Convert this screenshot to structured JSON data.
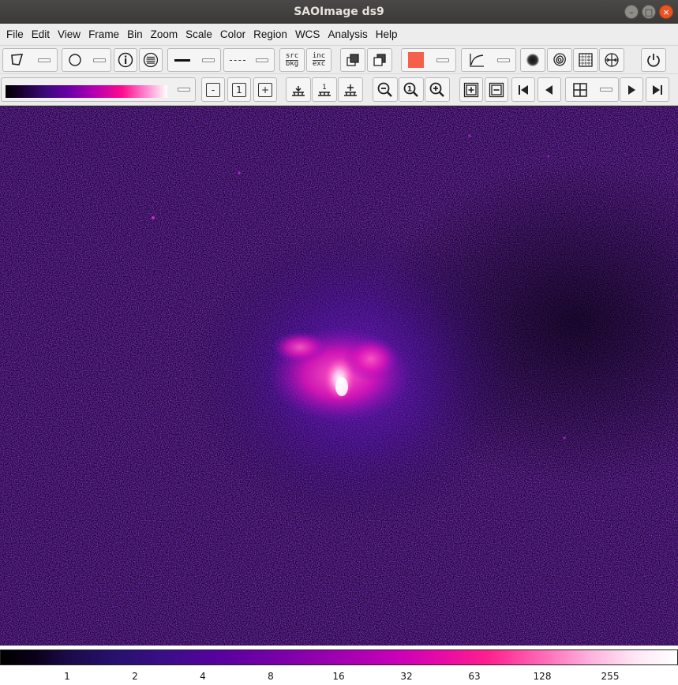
{
  "window": {
    "title": "SAOImage ds9"
  },
  "menubar": [
    "File",
    "Edit",
    "View",
    "Frame",
    "Bin",
    "Zoom",
    "Scale",
    "Color",
    "Region",
    "WCS",
    "Analysis",
    "Help"
  ],
  "toolbar1": {
    "src_bkg": [
      "src",
      "bkg"
    ],
    "inc_exc": [
      "inc",
      "exc"
    ],
    "region_color": "#f5604b"
  },
  "toolbar2": {
    "minus_label": "-",
    "one_label": "1",
    "plus_label": "+"
  },
  "colorbar": {
    "ticks": [
      "1",
      "2",
      "4",
      "8",
      "16",
      "32",
      "63",
      "128",
      "255"
    ]
  },
  "image": {
    "colormap": "magenta-hot",
    "background": "#0e0420"
  }
}
